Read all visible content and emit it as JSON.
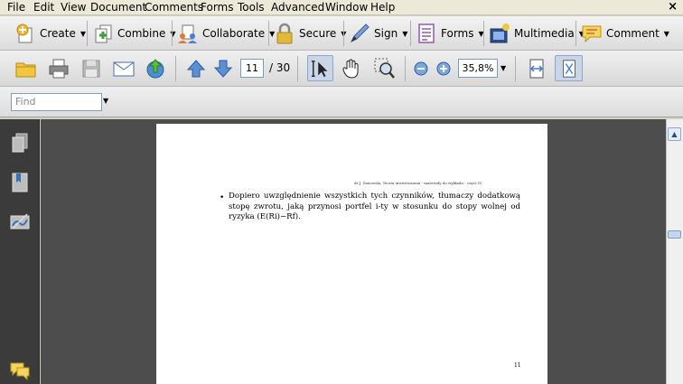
{
  "menu": {
    "items": [
      "File",
      "Edit",
      "View",
      "Document",
      "Comments",
      "Forms",
      "Tools",
      "Advanced",
      "Window",
      "Help"
    ],
    "close_symbol": "×"
  },
  "tasks": {
    "create": "Create",
    "combine": "Combine",
    "collaborate": "Collaborate",
    "secure": "Secure",
    "sign": "Sign",
    "forms": "Forms",
    "multimedia": "Multimedia",
    "comment": "Comment"
  },
  "navigation": {
    "current_page": "11",
    "total_pages": "/ 30",
    "zoom": "35,8%"
  },
  "find": {
    "placeholder": "Find"
  },
  "document": {
    "header": "dr J. Żmiowski, Teoria inwestowania - materiały do wykładu - część IV",
    "bullet": "•",
    "paragraph": "Dopiero uwzględnienie wszystkich tych czynników, tłumaczy dodatkową stopę zwrotu, jaką przynosi portfel i-ty w stosunku do stopy wolnej od ryzyka (E(Ri)−Rf).",
    "page_number": "11"
  },
  "colors": {
    "menu_bg": "#ece9d8",
    "toolbar_bg": "#e6e6e6",
    "panel_dark": "#3b3b3b",
    "doc_bg": "#4d4d4d",
    "accent_blue": "#3d7bd9"
  }
}
